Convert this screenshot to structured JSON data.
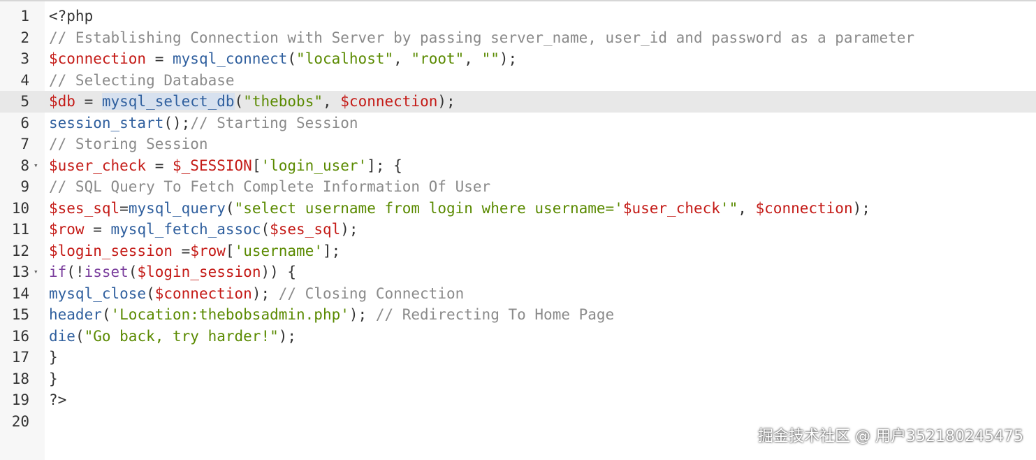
{
  "editor": {
    "active_line": 5,
    "lines": [
      {
        "num": "1",
        "fold": false,
        "tokens": [
          {
            "t": "<?php",
            "c": "plain"
          }
        ]
      },
      {
        "num": "2",
        "fold": false,
        "tokens": [
          {
            "t": "// Establishing Connection with Server by passing server_name, user_id and password as a parameter",
            "c": "comment"
          }
        ]
      },
      {
        "num": "3",
        "fold": false,
        "tokens": [
          {
            "t": "$connection",
            "c": "var"
          },
          {
            "t": " = ",
            "c": "plain"
          },
          {
            "t": "mysql_connect",
            "c": "func"
          },
          {
            "t": "(",
            "c": "plain"
          },
          {
            "t": "\"localhost\"",
            "c": "str"
          },
          {
            "t": ", ",
            "c": "plain"
          },
          {
            "t": "\"root\"",
            "c": "str"
          },
          {
            "t": ", ",
            "c": "plain"
          },
          {
            "t": "\"\"",
            "c": "str"
          },
          {
            "t": ");",
            "c": "plain"
          }
        ]
      },
      {
        "num": "4",
        "fold": false,
        "tokens": [
          {
            "t": "// Selecting Database",
            "c": "comment"
          }
        ]
      },
      {
        "num": "5",
        "fold": false,
        "tokens": [
          {
            "t": "$db",
            "c": "var"
          },
          {
            "t": " = ",
            "c": "plain"
          },
          {
            "t": "mysql_select_db",
            "c": "func",
            "sel": true
          },
          {
            "t": "(",
            "c": "plain"
          },
          {
            "t": "\"thebobs\"",
            "c": "str"
          },
          {
            "t": ", ",
            "c": "plain"
          },
          {
            "t": "$connection",
            "c": "var"
          },
          {
            "t": ");",
            "c": "plain"
          }
        ]
      },
      {
        "num": "6",
        "fold": false,
        "tokens": [
          {
            "t": "session_start",
            "c": "func"
          },
          {
            "t": "();",
            "c": "plain"
          },
          {
            "t": "// Starting Session",
            "c": "comment"
          }
        ]
      },
      {
        "num": "7",
        "fold": false,
        "tokens": [
          {
            "t": "// Storing Session",
            "c": "comment"
          }
        ]
      },
      {
        "num": "8",
        "fold": true,
        "tokens": [
          {
            "t": "$user_check",
            "c": "var"
          },
          {
            "t": " = ",
            "c": "plain"
          },
          {
            "t": "$_SESSION",
            "c": "var"
          },
          {
            "t": "[",
            "c": "plain"
          },
          {
            "t": "'login_user'",
            "c": "str"
          },
          {
            "t": "]; {",
            "c": "plain"
          }
        ]
      },
      {
        "num": "9",
        "fold": false,
        "tokens": [
          {
            "t": "// SQL Query To Fetch Complete Information Of User",
            "c": "comment"
          }
        ]
      },
      {
        "num": "10",
        "fold": false,
        "tokens": [
          {
            "t": "$ses_sql",
            "c": "var"
          },
          {
            "t": "=",
            "c": "plain"
          },
          {
            "t": "mysql_query",
            "c": "func"
          },
          {
            "t": "(",
            "c": "plain"
          },
          {
            "t": "\"select username from login where username='",
            "c": "str"
          },
          {
            "t": "$user_check",
            "c": "var"
          },
          {
            "t": "'\"",
            "c": "str"
          },
          {
            "t": ", ",
            "c": "plain"
          },
          {
            "t": "$connection",
            "c": "var"
          },
          {
            "t": ");",
            "c": "plain"
          }
        ]
      },
      {
        "num": "11",
        "fold": false,
        "tokens": [
          {
            "t": "$row",
            "c": "var"
          },
          {
            "t": " = ",
            "c": "plain"
          },
          {
            "t": "mysql_fetch_assoc",
            "c": "func"
          },
          {
            "t": "(",
            "c": "plain"
          },
          {
            "t": "$ses_sql",
            "c": "var"
          },
          {
            "t": ");",
            "c": "plain"
          }
        ]
      },
      {
        "num": "12",
        "fold": false,
        "tokens": [
          {
            "t": "$login_session",
            "c": "var"
          },
          {
            "t": " =",
            "c": "plain"
          },
          {
            "t": "$row",
            "c": "var"
          },
          {
            "t": "[",
            "c": "plain"
          },
          {
            "t": "'username'",
            "c": "str"
          },
          {
            "t": "];",
            "c": "plain"
          }
        ]
      },
      {
        "num": "13",
        "fold": true,
        "tokens": [
          {
            "t": "if",
            "c": "kw"
          },
          {
            "t": "(!",
            "c": "plain"
          },
          {
            "t": "isset",
            "c": "kw"
          },
          {
            "t": "(",
            "c": "plain"
          },
          {
            "t": "$login_session",
            "c": "var"
          },
          {
            "t": ")) {",
            "c": "plain"
          }
        ]
      },
      {
        "num": "14",
        "fold": false,
        "tokens": [
          {
            "t": "mysql_close",
            "c": "func"
          },
          {
            "t": "(",
            "c": "plain"
          },
          {
            "t": "$connection",
            "c": "var"
          },
          {
            "t": "); ",
            "c": "plain"
          },
          {
            "t": "// Closing Connection",
            "c": "comment"
          }
        ]
      },
      {
        "num": "15",
        "fold": false,
        "tokens": [
          {
            "t": "header",
            "c": "func"
          },
          {
            "t": "(",
            "c": "plain"
          },
          {
            "t": "'Location:thebobsadmin.php'",
            "c": "str"
          },
          {
            "t": "); ",
            "c": "plain"
          },
          {
            "t": "// Redirecting To Home Page",
            "c": "comment"
          }
        ]
      },
      {
        "num": "16",
        "fold": false,
        "tokens": [
          {
            "t": "die",
            "c": "func"
          },
          {
            "t": "(",
            "c": "plain"
          },
          {
            "t": "\"Go back, try harder!\"",
            "c": "str"
          },
          {
            "t": ");",
            "c": "plain"
          }
        ]
      },
      {
        "num": "17",
        "fold": false,
        "tokens": [
          {
            "t": "}",
            "c": "plain"
          }
        ]
      },
      {
        "num": "18",
        "fold": false,
        "tokens": [
          {
            "t": "}",
            "c": "plain"
          }
        ]
      },
      {
        "num": "19",
        "fold": false,
        "tokens": [
          {
            "t": "?>",
            "c": "plain"
          }
        ]
      },
      {
        "num": "20",
        "fold": false,
        "tokens": []
      }
    ]
  },
  "watermark": {
    "text": "掘金技术社区 @ 用户352180245475"
  },
  "colors": {
    "comment": "#8a8a8a",
    "variable": "#c41a16",
    "function": "#2f5f9e",
    "string": "#5a8a00",
    "keyword": "#7a3e9d",
    "active_line_bg": "#e8e8e8"
  }
}
